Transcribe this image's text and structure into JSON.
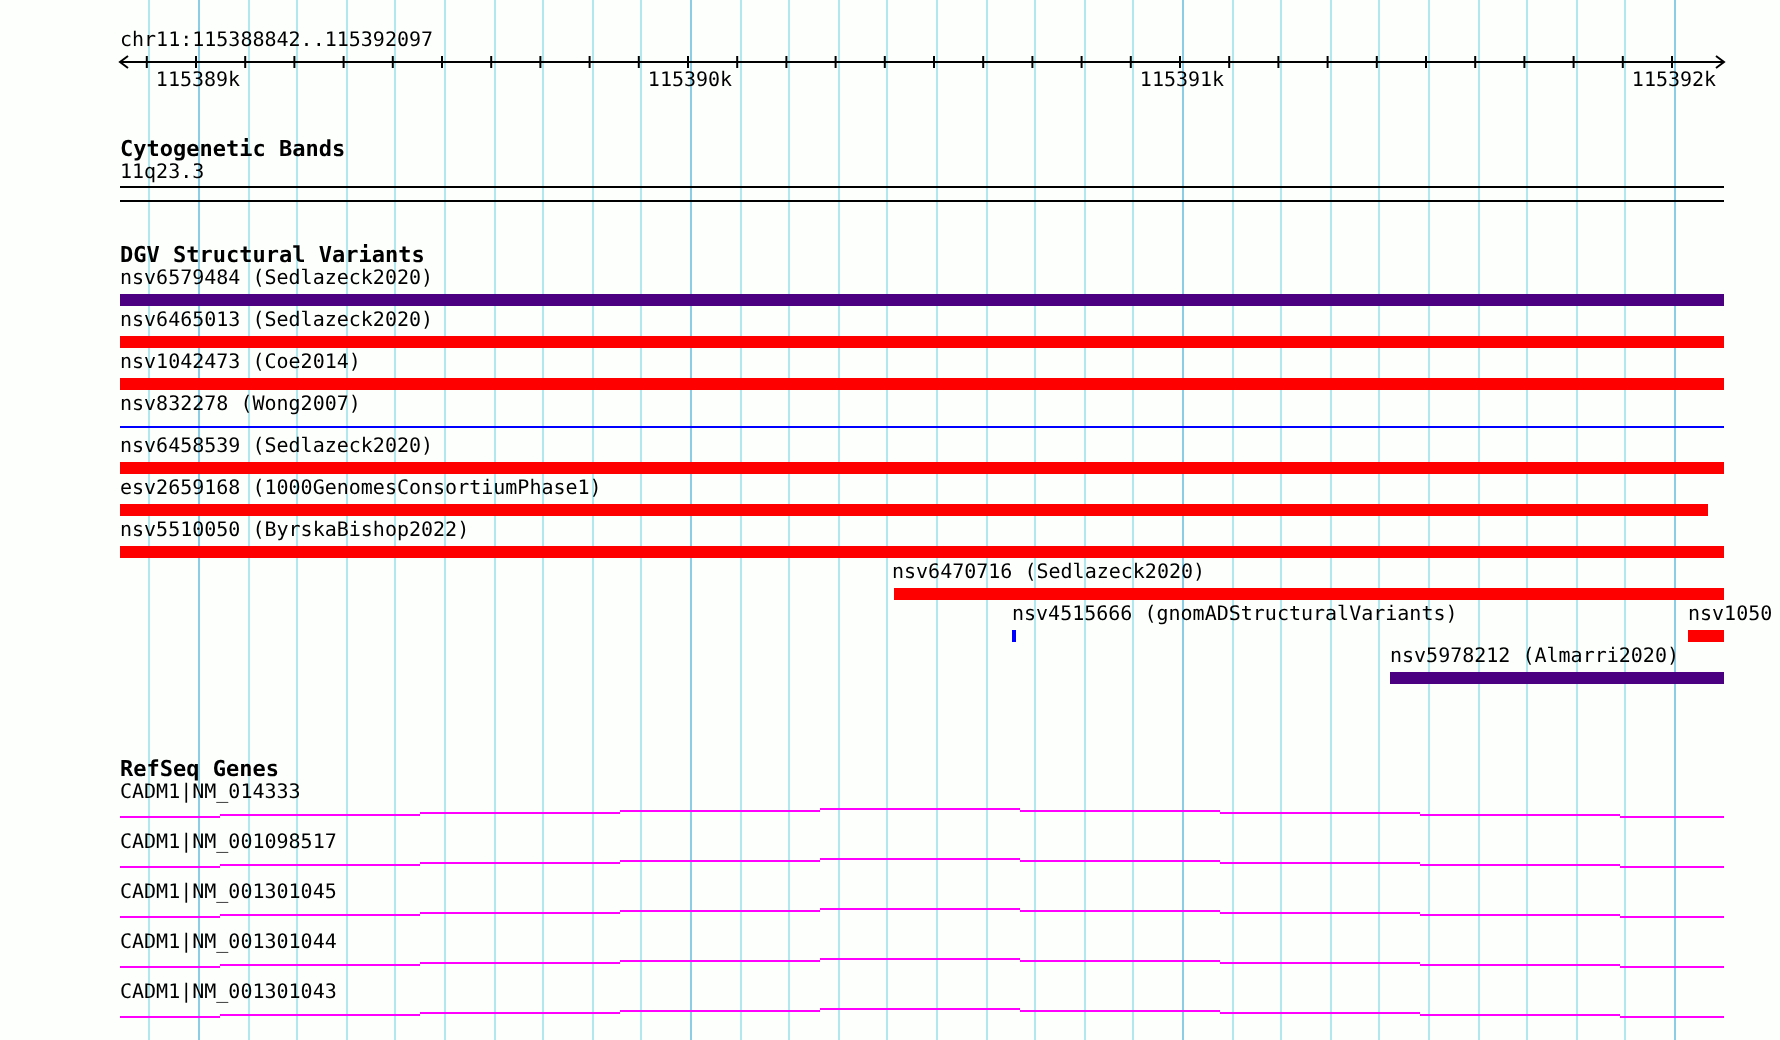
{
  "location": "chr11:115388842..115392097",
  "ruler": {
    "ticks": [
      "115389k",
      "115390k",
      "115391k",
      "115392k"
    ]
  },
  "tracks": [
    {
      "kind": "bands",
      "title": "Cytogenetic Bands",
      "features": [
        {
          "label": "11q23.3"
        }
      ]
    },
    {
      "kind": "variants",
      "title": "DGV Structural Variants",
      "features": [
        {
          "label": "nsv6579484 (Sedlazeck2020)",
          "color": "#4b0082",
          "kind": "bar"
        },
        {
          "label": "nsv6465013 (Sedlazeck2020)",
          "color": "#ff0000",
          "kind": "bar"
        },
        {
          "label": "nsv1042473 (Coe2014)",
          "color": "#ff0000",
          "kind": "bar"
        },
        {
          "label": "nsv832278 (Wong2007)",
          "color": "#0000ff",
          "kind": "line"
        },
        {
          "label": "nsv6458539 (Sedlazeck2020)",
          "color": "#ff0000",
          "kind": "bar"
        },
        {
          "label": "esv2659168 (1000GenomesConsortiumPhase1)",
          "color": "#ff0000",
          "kind": "bar"
        },
        {
          "label": "nsv5510050 (ByrskaBishop2022)",
          "color": "#ff0000",
          "kind": "bar"
        },
        {
          "label": "nsv6470716 (Sedlazeck2020)",
          "color": "#ff0000",
          "kind": "bar"
        },
        {
          "label": "nsv4515666 (gnomADStructuralVariants)",
          "color": "#0000ff",
          "kind": "bar"
        },
        {
          "label": "nsv1050",
          "color": "#ff0000",
          "kind": "bar"
        },
        {
          "label": "nsv5978212 (Almarri2020)",
          "color": "#4b0082",
          "kind": "bar"
        }
      ]
    },
    {
      "kind": "genes",
      "title": "RefSeq Genes",
      "features": [
        {
          "label": "CADM1|NM_014333"
        },
        {
          "label": "CADM1|NM_001098517"
        },
        {
          "label": "CADM1|NM_001301045"
        },
        {
          "label": "CADM1|NM_001301044"
        },
        {
          "label": "CADM1|NM_001301043"
        }
      ]
    }
  ]
}
